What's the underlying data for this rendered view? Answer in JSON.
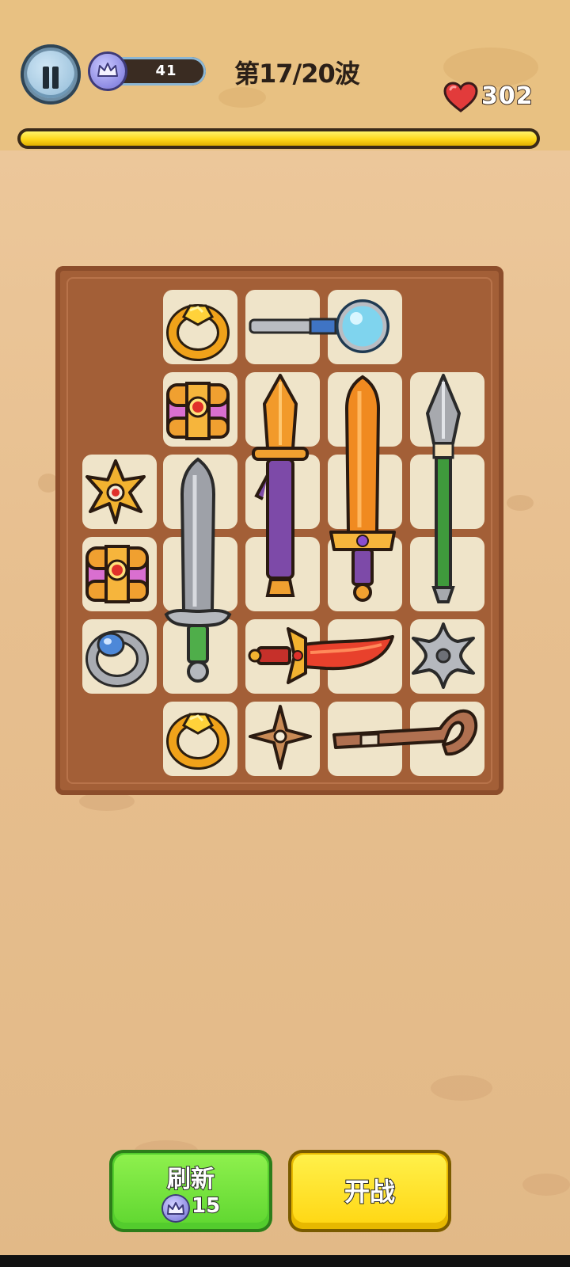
{
  "hud": {
    "gem_count": "41",
    "wave_label": "第17/20波",
    "hp": "302",
    "wave_progress": 1.0
  },
  "board": {
    "items": [
      {
        "name": "gold-ring-icon"
      },
      {
        "name": "magnifying-staff-icon"
      },
      {
        "name": "treasure-chest-icon"
      },
      {
        "name": "orange-dagger-icon"
      },
      {
        "name": "orange-greatsword-icon"
      },
      {
        "name": "green-spear-icon"
      },
      {
        "name": "gold-shuriken-icon"
      },
      {
        "name": "steel-sword-icon"
      },
      {
        "name": "treasure-chest-icon"
      },
      {
        "name": "silver-ring-icon"
      },
      {
        "name": "red-blade-icon"
      },
      {
        "name": "silver-shuriken-icon"
      },
      {
        "name": "gold-ring-icon"
      },
      {
        "name": "bronze-shuriken-icon"
      },
      {
        "name": "wooden-cane-icon"
      }
    ]
  },
  "buttons": {
    "refresh_label": "刷新",
    "refresh_cost": "15",
    "fight_label": "开战"
  },
  "colors": {
    "background": "#e5be8e",
    "board": "#a35f37",
    "cell": "#efe4c9",
    "progress": "#ffd81a",
    "refresh_button": "#62d832",
    "fight_button": "#ffd816"
  }
}
